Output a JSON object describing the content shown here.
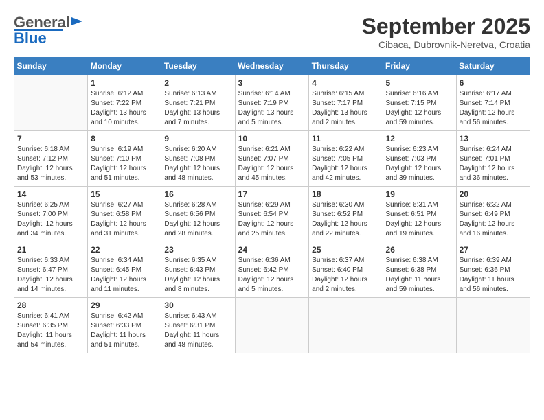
{
  "header": {
    "logo_general": "General",
    "logo_blue": "Blue",
    "month_title": "September 2025",
    "subtitle": "Cibaca, Dubrovnik-Neretva, Croatia"
  },
  "days_of_week": [
    "Sunday",
    "Monday",
    "Tuesday",
    "Wednesday",
    "Thursday",
    "Friday",
    "Saturday"
  ],
  "weeks": [
    [
      {
        "day": "",
        "info": ""
      },
      {
        "day": "1",
        "info": "Sunrise: 6:12 AM\nSunset: 7:22 PM\nDaylight: 13 hours\nand 10 minutes."
      },
      {
        "day": "2",
        "info": "Sunrise: 6:13 AM\nSunset: 7:21 PM\nDaylight: 13 hours\nand 7 minutes."
      },
      {
        "day": "3",
        "info": "Sunrise: 6:14 AM\nSunset: 7:19 PM\nDaylight: 13 hours\nand 5 minutes."
      },
      {
        "day": "4",
        "info": "Sunrise: 6:15 AM\nSunset: 7:17 PM\nDaylight: 13 hours\nand 2 minutes."
      },
      {
        "day": "5",
        "info": "Sunrise: 6:16 AM\nSunset: 7:15 PM\nDaylight: 12 hours\nand 59 minutes."
      },
      {
        "day": "6",
        "info": "Sunrise: 6:17 AM\nSunset: 7:14 PM\nDaylight: 12 hours\nand 56 minutes."
      }
    ],
    [
      {
        "day": "7",
        "info": "Sunrise: 6:18 AM\nSunset: 7:12 PM\nDaylight: 12 hours\nand 53 minutes."
      },
      {
        "day": "8",
        "info": "Sunrise: 6:19 AM\nSunset: 7:10 PM\nDaylight: 12 hours\nand 51 minutes."
      },
      {
        "day": "9",
        "info": "Sunrise: 6:20 AM\nSunset: 7:08 PM\nDaylight: 12 hours\nand 48 minutes."
      },
      {
        "day": "10",
        "info": "Sunrise: 6:21 AM\nSunset: 7:07 PM\nDaylight: 12 hours\nand 45 minutes."
      },
      {
        "day": "11",
        "info": "Sunrise: 6:22 AM\nSunset: 7:05 PM\nDaylight: 12 hours\nand 42 minutes."
      },
      {
        "day": "12",
        "info": "Sunrise: 6:23 AM\nSunset: 7:03 PM\nDaylight: 12 hours\nand 39 minutes."
      },
      {
        "day": "13",
        "info": "Sunrise: 6:24 AM\nSunset: 7:01 PM\nDaylight: 12 hours\nand 36 minutes."
      }
    ],
    [
      {
        "day": "14",
        "info": "Sunrise: 6:25 AM\nSunset: 7:00 PM\nDaylight: 12 hours\nand 34 minutes."
      },
      {
        "day": "15",
        "info": "Sunrise: 6:27 AM\nSunset: 6:58 PM\nDaylight: 12 hours\nand 31 minutes."
      },
      {
        "day": "16",
        "info": "Sunrise: 6:28 AM\nSunset: 6:56 PM\nDaylight: 12 hours\nand 28 minutes."
      },
      {
        "day": "17",
        "info": "Sunrise: 6:29 AM\nSunset: 6:54 PM\nDaylight: 12 hours\nand 25 minutes."
      },
      {
        "day": "18",
        "info": "Sunrise: 6:30 AM\nSunset: 6:52 PM\nDaylight: 12 hours\nand 22 minutes."
      },
      {
        "day": "19",
        "info": "Sunrise: 6:31 AM\nSunset: 6:51 PM\nDaylight: 12 hours\nand 19 minutes."
      },
      {
        "day": "20",
        "info": "Sunrise: 6:32 AM\nSunset: 6:49 PM\nDaylight: 12 hours\nand 16 minutes."
      }
    ],
    [
      {
        "day": "21",
        "info": "Sunrise: 6:33 AM\nSunset: 6:47 PM\nDaylight: 12 hours\nand 14 minutes."
      },
      {
        "day": "22",
        "info": "Sunrise: 6:34 AM\nSunset: 6:45 PM\nDaylight: 12 hours\nand 11 minutes."
      },
      {
        "day": "23",
        "info": "Sunrise: 6:35 AM\nSunset: 6:43 PM\nDaylight: 12 hours\nand 8 minutes."
      },
      {
        "day": "24",
        "info": "Sunrise: 6:36 AM\nSunset: 6:42 PM\nDaylight: 12 hours\nand 5 minutes."
      },
      {
        "day": "25",
        "info": "Sunrise: 6:37 AM\nSunset: 6:40 PM\nDaylight: 12 hours\nand 2 minutes."
      },
      {
        "day": "26",
        "info": "Sunrise: 6:38 AM\nSunset: 6:38 PM\nDaylight: 11 hours\nand 59 minutes."
      },
      {
        "day": "27",
        "info": "Sunrise: 6:39 AM\nSunset: 6:36 PM\nDaylight: 11 hours\nand 56 minutes."
      }
    ],
    [
      {
        "day": "28",
        "info": "Sunrise: 6:41 AM\nSunset: 6:35 PM\nDaylight: 11 hours\nand 54 minutes."
      },
      {
        "day": "29",
        "info": "Sunrise: 6:42 AM\nSunset: 6:33 PM\nDaylight: 11 hours\nand 51 minutes."
      },
      {
        "day": "30",
        "info": "Sunrise: 6:43 AM\nSunset: 6:31 PM\nDaylight: 11 hours\nand 48 minutes."
      },
      {
        "day": "",
        "info": ""
      },
      {
        "day": "",
        "info": ""
      },
      {
        "day": "",
        "info": ""
      },
      {
        "day": "",
        "info": ""
      }
    ]
  ]
}
